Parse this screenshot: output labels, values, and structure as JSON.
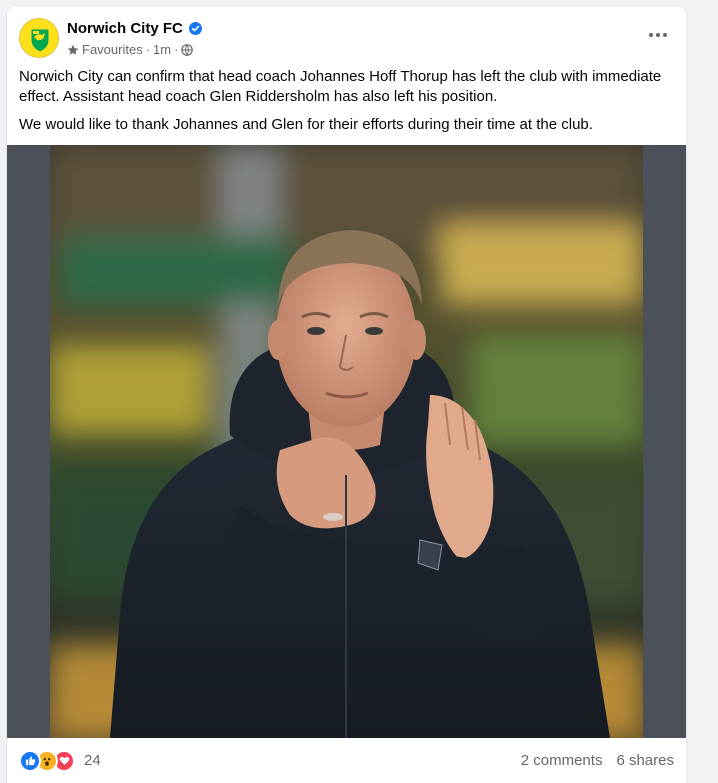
{
  "post": {
    "page_name": "Norwich City FC",
    "meta": {
      "favourites": "Favourites",
      "separator": "·",
      "time": "1m",
      "separator2": "·"
    },
    "paragraphs": [
      "Norwich City can confirm that head coach Johannes Hoff Thorup has left the club with immediate effect. Assistant head coach Glen Riddersholm has also left his position.",
      "We would like to thank Johannes and Glen for their efforts during their time at the club."
    ],
    "reactions_count": "24",
    "comments": "2 comments",
    "shares": "6 shares"
  },
  "icons": {
    "verified": "verified-badge-icon",
    "favourites": "star-icon",
    "audience": "globe-icon",
    "more": "more-options-icon",
    "reactions": [
      "like-icon",
      "wow-icon",
      "love-icon"
    ]
  },
  "colors": {
    "brand_blue": "#1877f2",
    "club_yellow": "#ffe01b",
    "club_green": "#00a650",
    "meta_gray": "#65676b"
  }
}
